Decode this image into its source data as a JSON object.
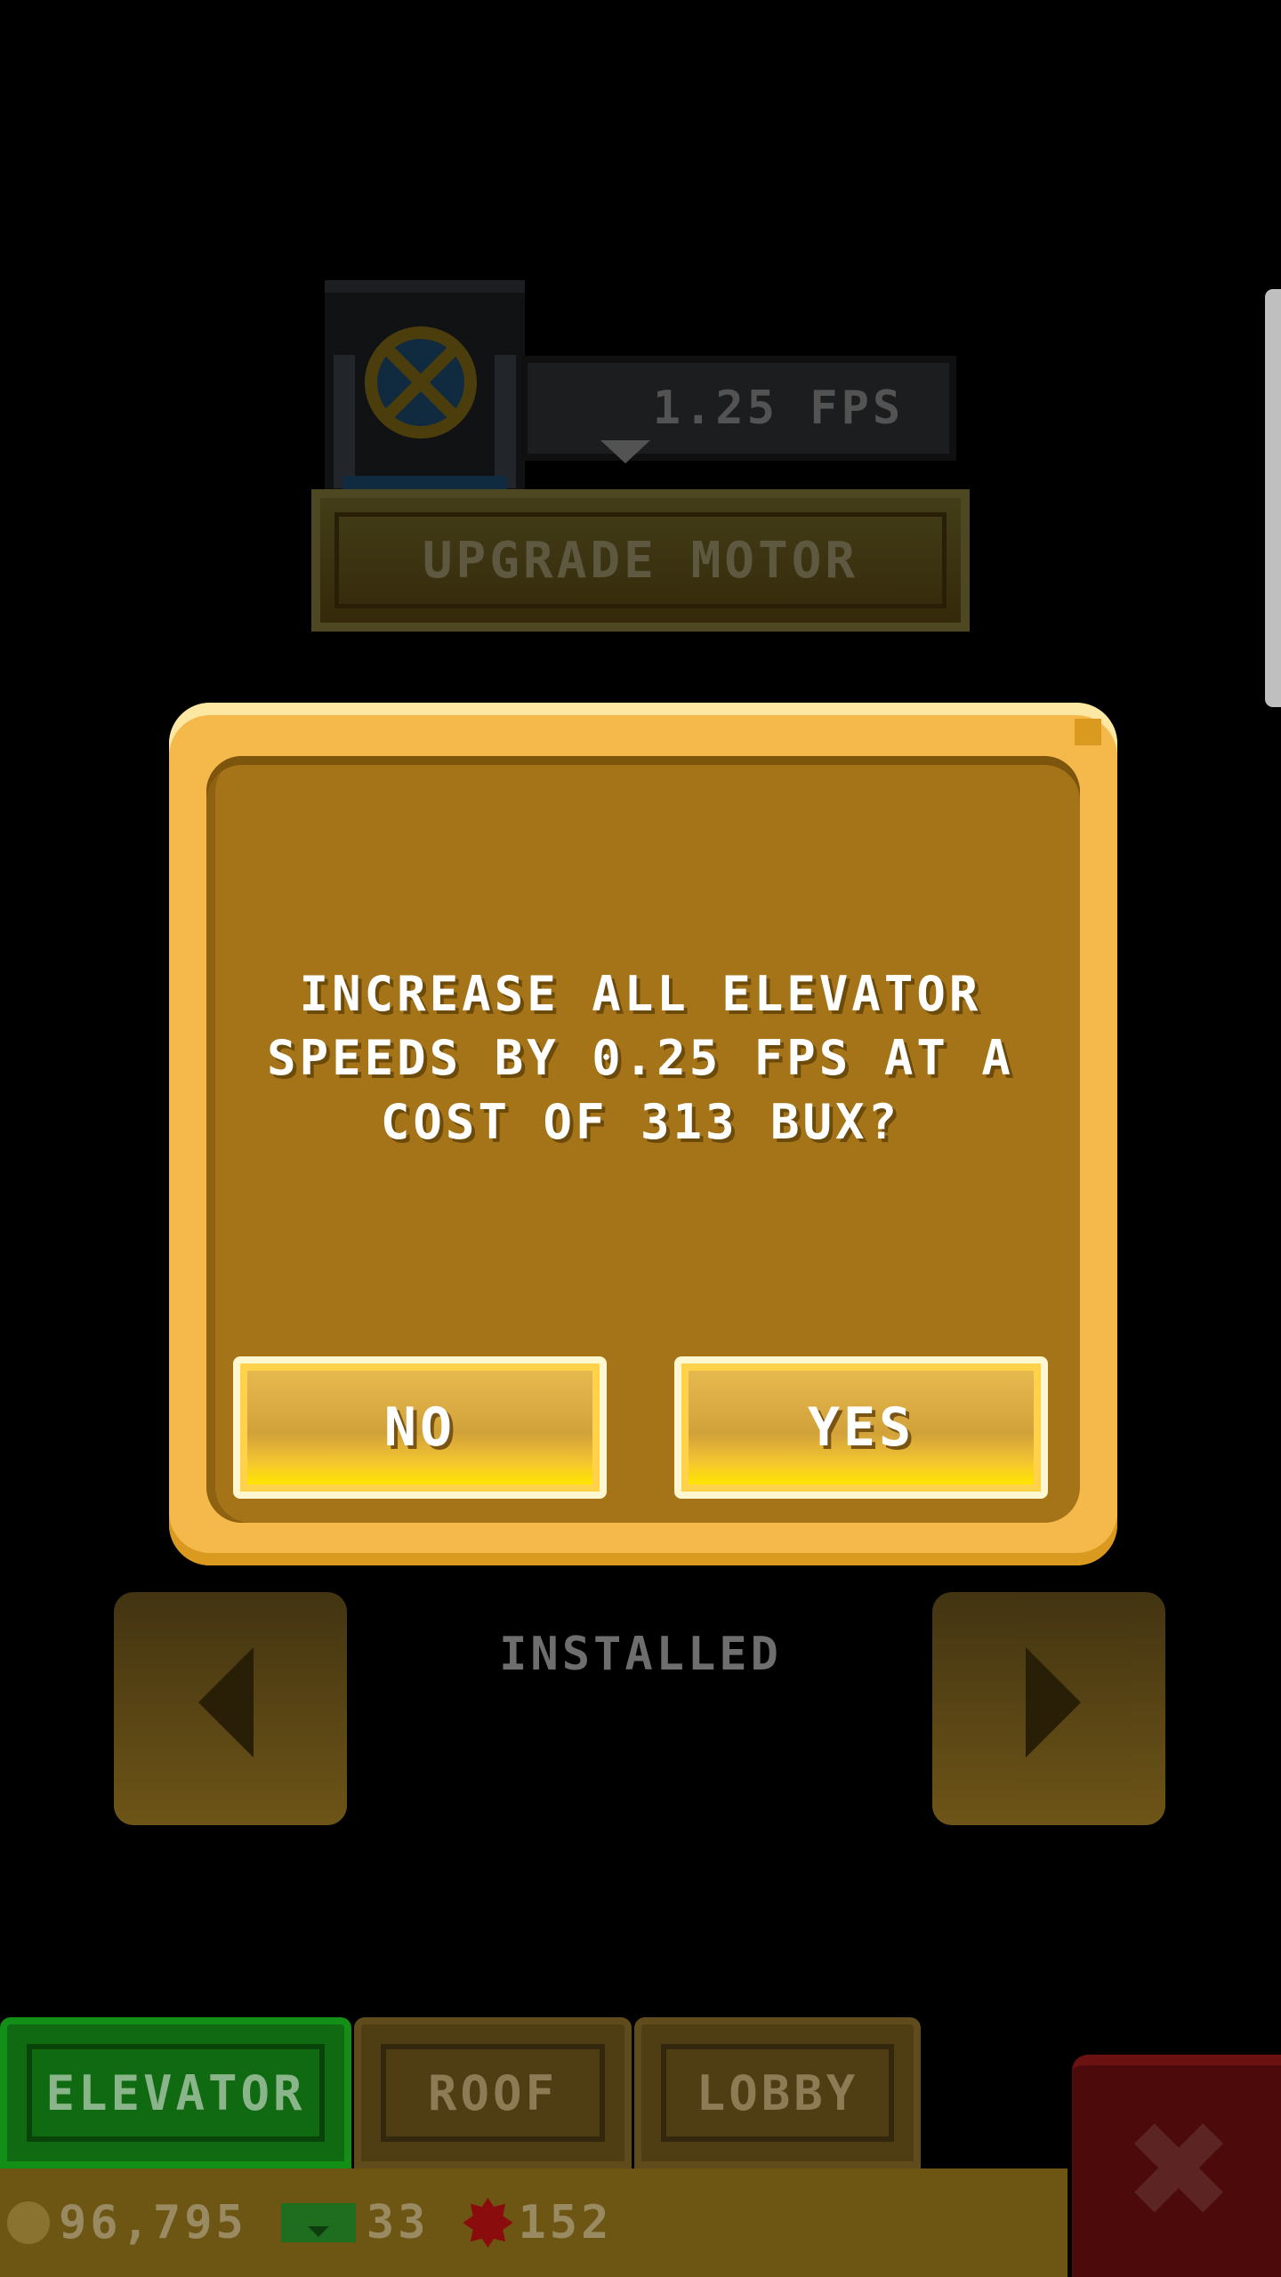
{
  "motor": {
    "speed_label": "1.25 FPS",
    "upgrade_label": "UPGRADE MOTOR"
  },
  "dialog": {
    "line1": "INCREASE ALL ELEVATOR",
    "line2": "SPEEDS BY 0.25 FPS AT A",
    "line3": "COST OF 313 BUX?",
    "no_label": "NO",
    "yes_label": "YES"
  },
  "carousel": {
    "status_label": "INSTALLED"
  },
  "tabs": [
    {
      "label": "ELEVATOR",
      "active": true
    },
    {
      "label": "ROOF",
      "active": false
    },
    {
      "label": "LOBBY",
      "active": false
    }
  ],
  "status": {
    "coins": "96,795",
    "bux": "33",
    "gems": "152"
  },
  "close": {
    "label": "✖"
  },
  "colors": {
    "dialog_border": "#f4b84b",
    "dialog_fill": "#a67418",
    "button_gold": "#ffd24a",
    "tab_active": "#0f6a12",
    "tab_inactive": "#4f3d14",
    "close_red": "#4c0a0a"
  }
}
